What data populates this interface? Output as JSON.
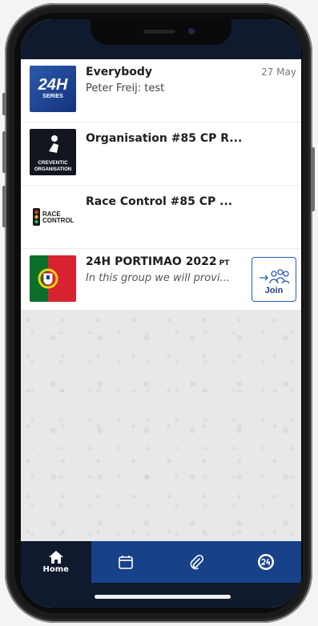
{
  "chats": [
    {
      "title": "Everybody",
      "subtitle": "Peter Freij: test",
      "date": "27 May",
      "avatar": {
        "line1": "24H",
        "line2": "SERIES",
        "bg": "#1a3d8f"
      }
    },
    {
      "title": "Organisation #85 CP R...",
      "avatar": {
        "line1": "CREVENTIC",
        "line2": "ORGANISATION",
        "bg": "#12161f"
      }
    },
    {
      "title": "Race Control #85 CP ...",
      "avatar": {
        "line1": "RACE",
        "line2": "CONTROL",
        "bg": "#ffffff"
      }
    },
    {
      "title": "24H PORTIMAO 2022",
      "tag": "PT",
      "subtitle": "In this group we will provi...",
      "join_label": "Join",
      "avatar": {
        "flag_green": "#0b6f2b",
        "flag_red": "#d7232f"
      }
    }
  ],
  "tabs": [
    {
      "label": "Home",
      "icon": "home-icon"
    },
    {
      "icon": "calendar-icon"
    },
    {
      "icon": "paperclip-icon"
    },
    {
      "icon": "24h-series-logo-icon"
    }
  ],
  "colors": {
    "navy": "#0f1a2e",
    "brand_blue": "#174188",
    "accent": "#2c5bb8"
  }
}
